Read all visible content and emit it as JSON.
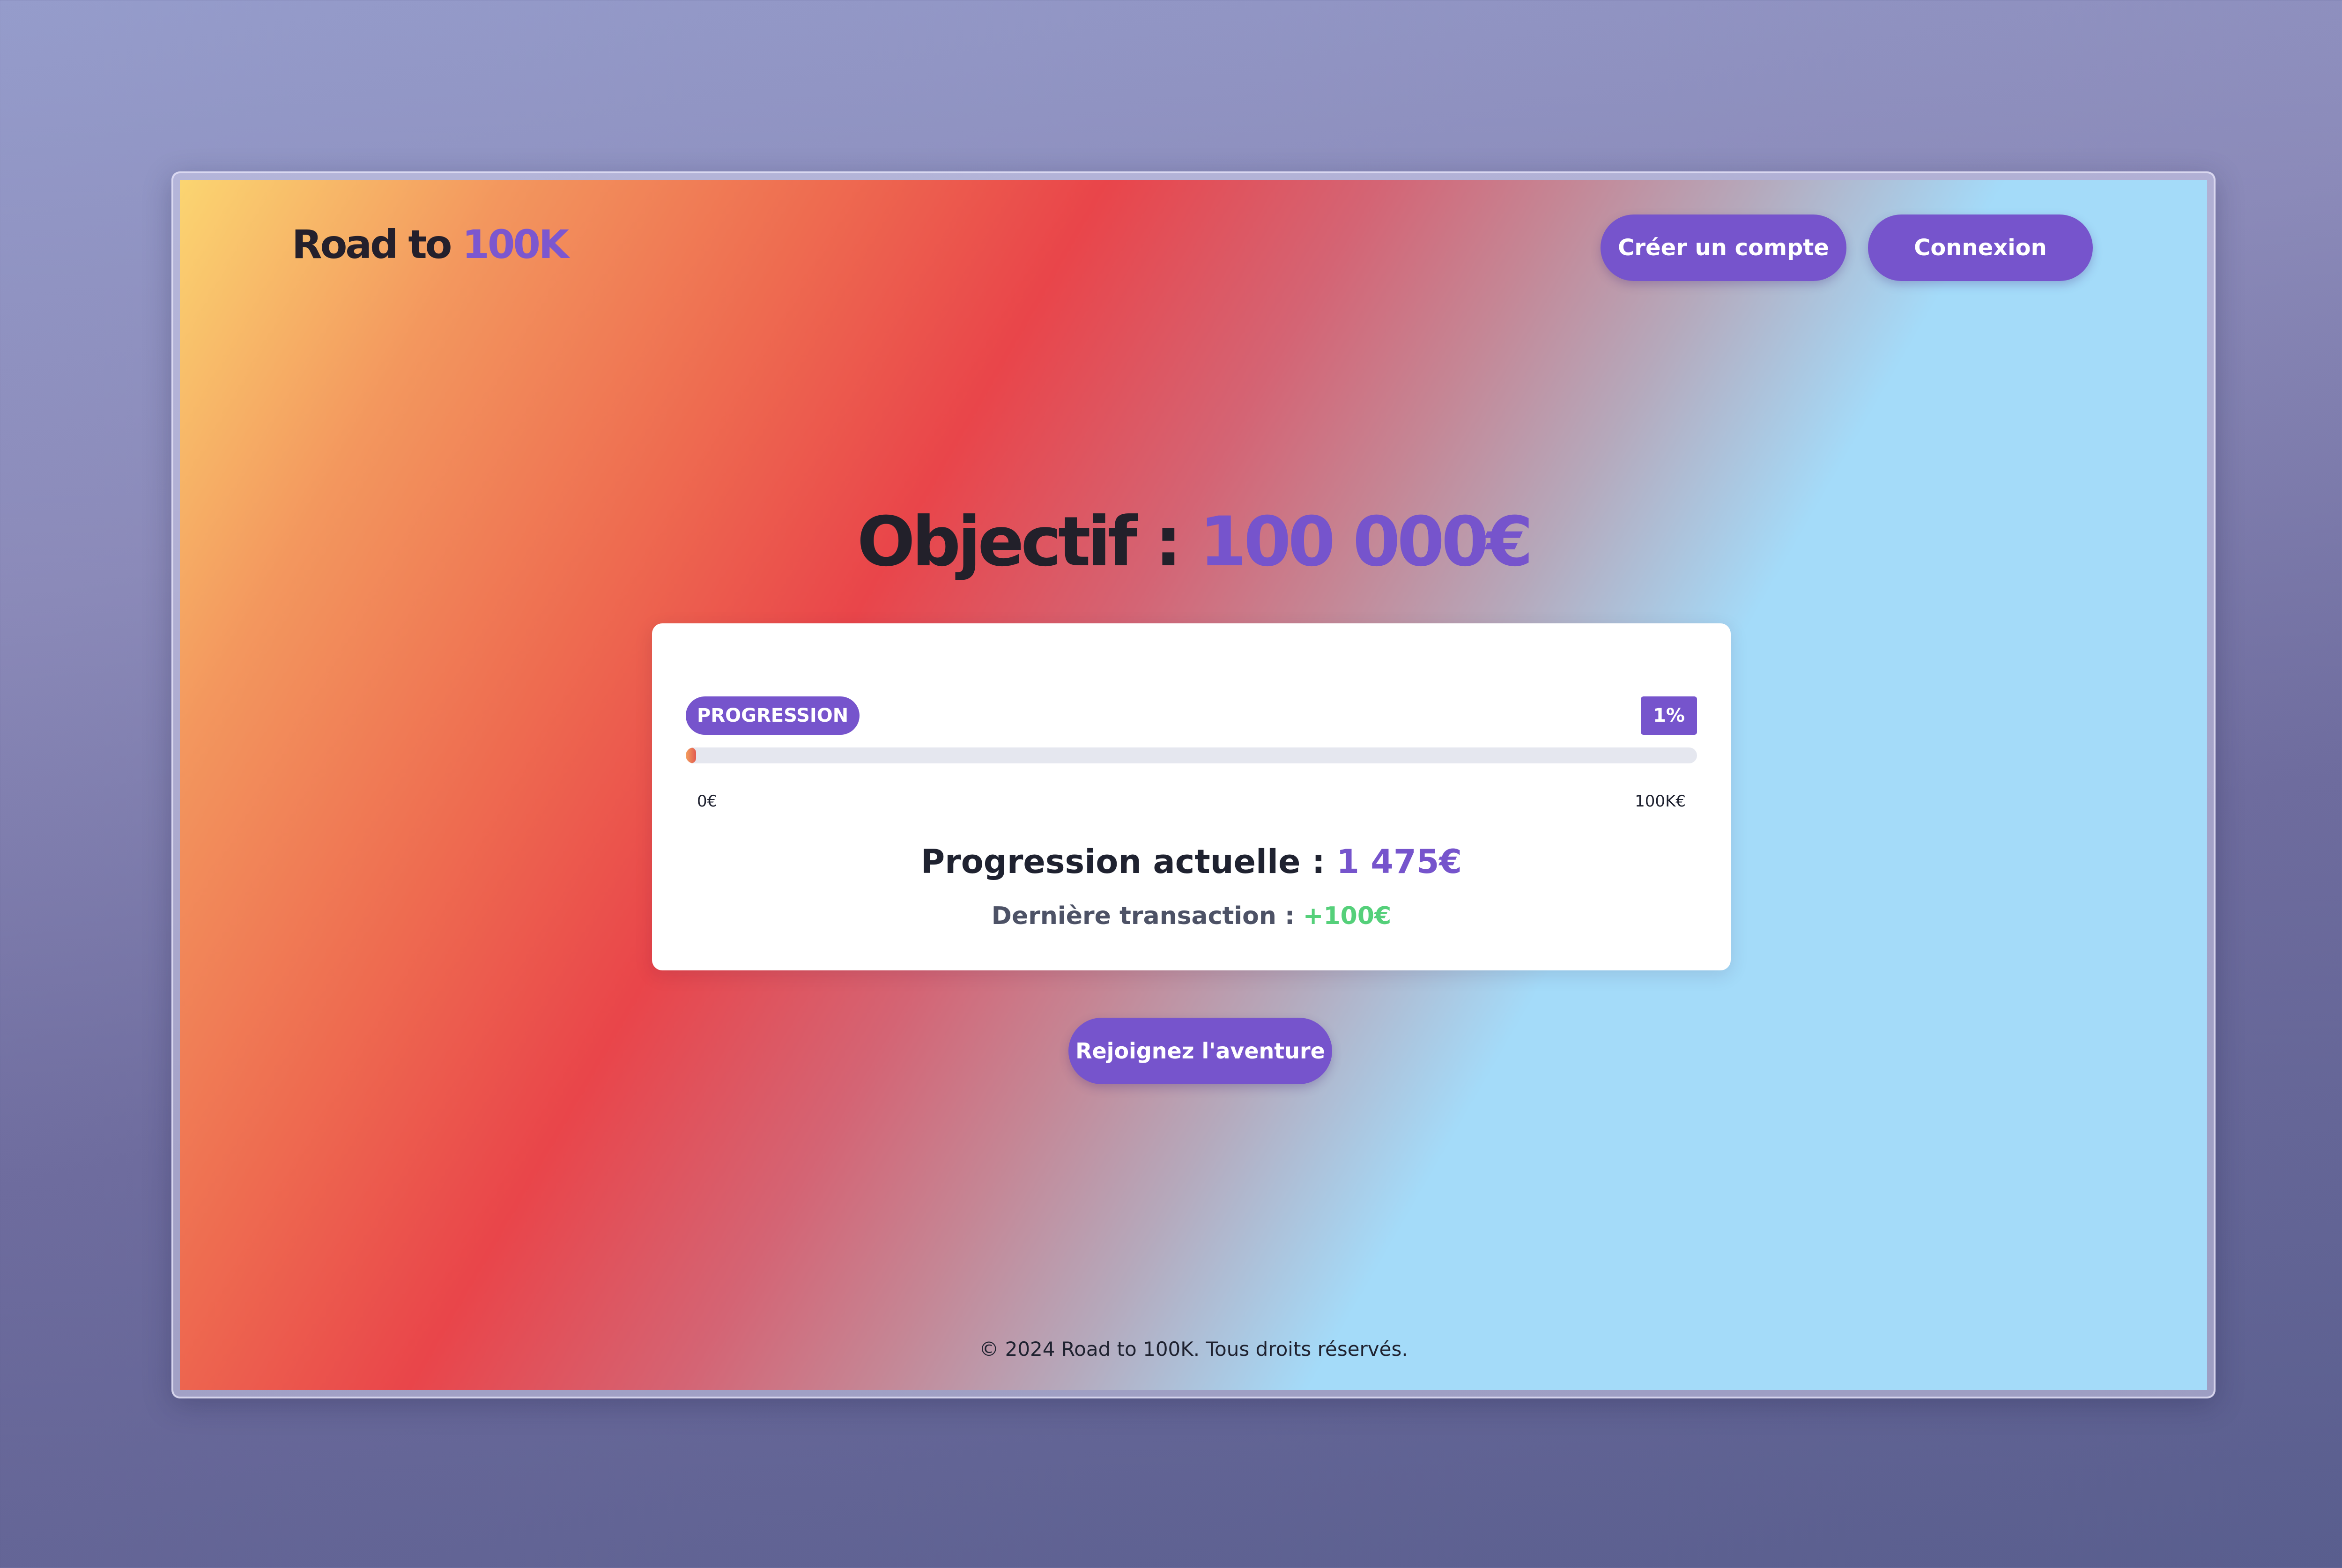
{
  "header": {
    "brand_prefix": "Road to",
    "brand_accent": "100K",
    "signup_label": "Créer un compte",
    "login_label": "Connexion"
  },
  "hero": {
    "title_prefix": "Objectif :",
    "title_amount": "100 000€"
  },
  "progress_card": {
    "tag": "PROGRESSION",
    "percent_label": "1%",
    "progress_fraction": 0.01,
    "scale_min": "0€",
    "scale_max": "100K€",
    "current_label": "Progression actuelle :",
    "current_value": "1 475€",
    "last_label": "Dernière transaction :",
    "last_value": "+100€"
  },
  "cta": {
    "join_label": "Rejoignez l'aventure"
  },
  "footer": {
    "copyright": "© 2024 Road to 100K. Tous droits réservés."
  },
  "colors": {
    "accent": "#7654cc",
    "positive": "#55d07a",
    "text_dark": "#1f2230"
  }
}
